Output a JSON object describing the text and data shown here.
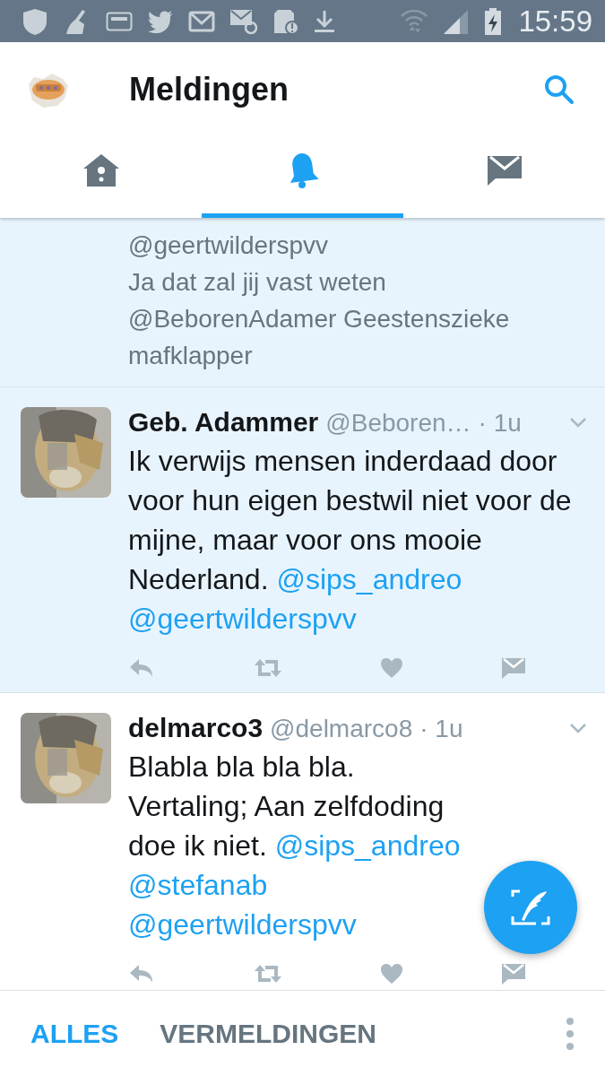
{
  "status_bar": {
    "time": "15:59"
  },
  "header": {
    "title": "Meldingen"
  },
  "tabs": [
    {
      "kind": "home",
      "selected": false
    },
    {
      "kind": "notifications",
      "selected": true
    },
    {
      "kind": "messages",
      "selected": false
    }
  ],
  "partial_tweet": {
    "highlighted": true,
    "lines": [
      "@geertwilderspvv",
      "Ja dat zal jij vast weten",
      "@BeborenAdamer  Geestenszieke",
      "mafklapper"
    ]
  },
  "tweets": [
    {
      "name": "Geb. Adammer",
      "handle": "@Beboren…",
      "time": "· 1u",
      "text": "Ik verwijs mensen inderdaad door voor hun eigen bestwil niet voor de mijne, maar voor ons mooie Nederland.",
      "mentions": [
        "@sips_andreo",
        "@geertwilderspvv"
      ],
      "highlighted": true
    },
    {
      "name": "delmarco3",
      "handle": "@delmarco8",
      "time": "· 1u",
      "text": "Blabla bla bla bla. Vertaling; Aan zelfdoding doe ik niet.",
      "mentions": [
        "@sips_andreo",
        "@stefanab",
        "@geertwilderspvv"
      ],
      "highlighted": false
    }
  ],
  "bottom_tabs": [
    {
      "label": "ALLES",
      "selected": true
    },
    {
      "label": "VERMELDINGEN",
      "selected": false
    }
  ]
}
